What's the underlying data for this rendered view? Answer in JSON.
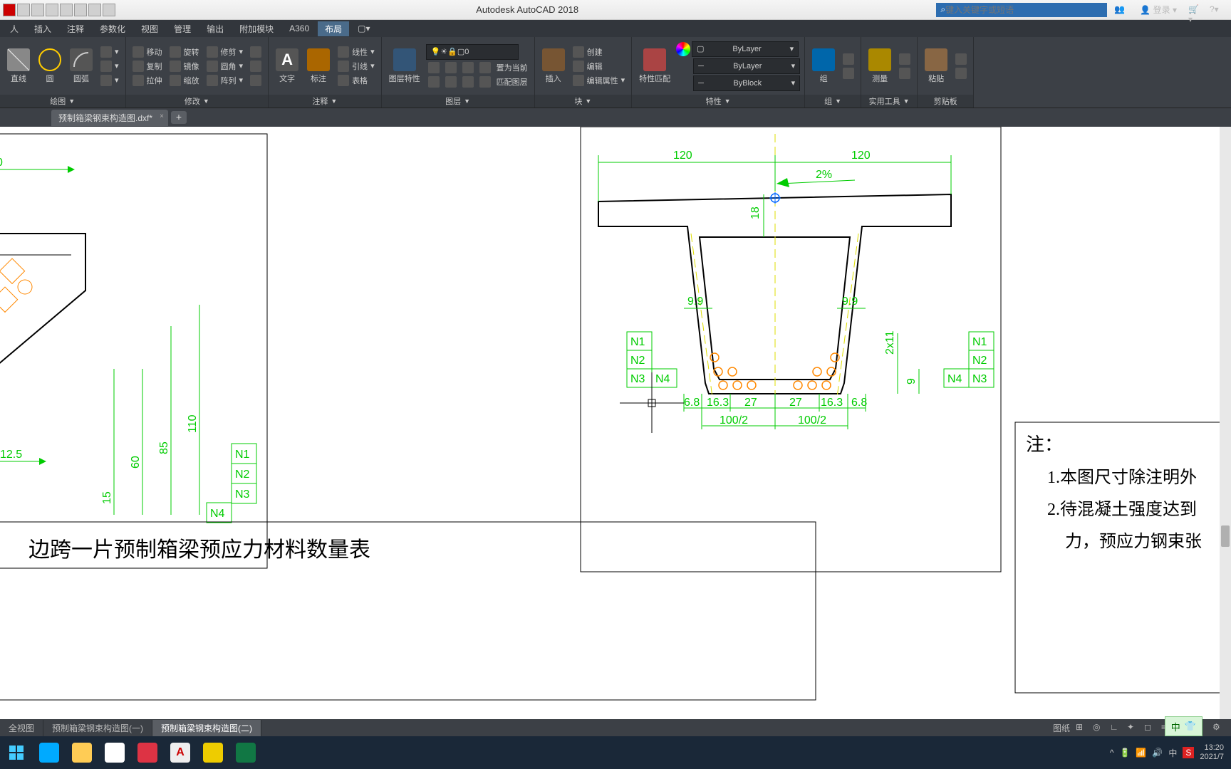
{
  "app": {
    "title": "Autodesk AutoCAD 2018"
  },
  "search": {
    "placeholder": "键入关键字或短语"
  },
  "title_right": {
    "login": "登录"
  },
  "menu": {
    "items": [
      "人",
      "插入",
      "注释",
      "参数化",
      "视图",
      "管理",
      "输出",
      "附加模块",
      "A360",
      "布局"
    ],
    "active_index": 9
  },
  "ribbon": {
    "panels": {
      "draw": {
        "title": "绘图",
        "items": [
          "直线",
          "圆",
          "圆弧"
        ]
      },
      "modify": {
        "title": "修改",
        "rows": [
          [
            "移动",
            "旋转",
            "修剪"
          ],
          [
            "复制",
            "镜像",
            "圆角"
          ],
          [
            "拉伸",
            "缩放",
            "阵列"
          ]
        ]
      },
      "annotate": {
        "title": "注释",
        "text": "文字",
        "dim": "标注",
        "leader": "引线",
        "line": "线性",
        "table": "表格"
      },
      "layer": {
        "title": "图层",
        "props": "图层特性",
        "c1": "置为当前",
        "c2": "匹配图层",
        "current": "0"
      },
      "block": {
        "title": "块",
        "insert": "插入",
        "create": "创建",
        "edit": "编辑",
        "editattr": "编辑属性"
      },
      "properties": {
        "title": "特性",
        "match": "特性匹配",
        "bylayer": "ByLayer",
        "byblock": "ByBlock"
      },
      "group": {
        "title": "组",
        "label": "组"
      },
      "util": {
        "title": "实用工具",
        "label": "测量"
      },
      "clip": {
        "title": "剪贴板",
        "label": "粘贴"
      }
    }
  },
  "doc_tabs": {
    "file": "预制箱梁钢束构造图.dxf*"
  },
  "layout_tabs": {
    "items": [
      "全视图",
      "预制箱梁钢束构造图(一)",
      "预制箱梁钢束构造图(二)"
    ],
    "active_index": 2,
    "status_label": "图纸"
  },
  "drawing": {
    "left": {
      "val_125": "12.5",
      "n1": "N1",
      "n2": "N2",
      "n3": "N3",
      "n4": "N4",
      "d15": "15",
      "d60": "60",
      "d85": "85",
      "d110": "110"
    },
    "center": {
      "top_120a": "120",
      "top_120b": "120",
      "slope": "2%",
      "d18": "18",
      "d99a": "9.9",
      "d99b": "9.9",
      "n1a": "N1",
      "n2a": "N2",
      "n3a": "N3",
      "n4a": "N4",
      "n1b": "N1",
      "n2b": "N2",
      "n3b": "N3",
      "n4b": "N4",
      "d2x11": "2x11",
      "d9": "9",
      "b_68a": "6.8",
      "b_163a": "16.3",
      "b_27a": "27",
      "b_27b": "27",
      "b_163b": "16.3",
      "b_68b": "6.8",
      "b_100a": "100/2",
      "b_100b": "100/2"
    },
    "notes": {
      "title": "注：",
      "n1": "1.本图尺寸除注明外",
      "n2": "2.待混凝土强度达到",
      "n3": "力，预应力钢束张"
    },
    "table_title": "边跨一片预制箱梁预应力材料数量表"
  },
  "taskbar": {
    "time": "13:20",
    "date": "2021/7",
    "lang1": "中",
    "lang2": "中"
  }
}
